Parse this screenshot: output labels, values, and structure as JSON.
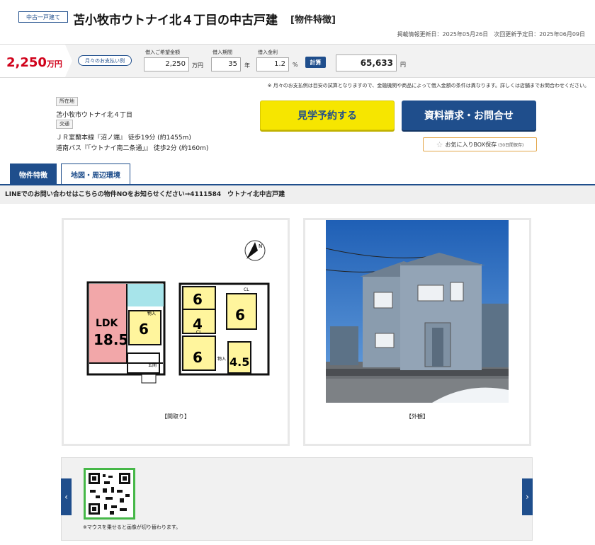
{
  "header": {
    "type_badge": "中古一戸建て",
    "title": "苫小牧市ウトナイ北４丁目の中古戸建",
    "title_suffix": "[物件特徴]",
    "dates": "掲載情報更新日：2025年05月26日　次回更新予定日：2025年06月09日"
  },
  "price": {
    "amount": "2,250",
    "unit": "万円",
    "monthly_pill": "月々のお支払い例"
  },
  "calculator": {
    "loan_label": "借入ご希望金額",
    "loan_value": "2,250",
    "loan_unit": "万円",
    "period_label": "借入期間",
    "period_value": "35",
    "period_unit": "年",
    "rate_label": "借入金利",
    "rate_value": "1.2",
    "rate_unit": "%",
    "calc_button": "計算",
    "result_value": "65,633",
    "result_unit": "円"
  },
  "disclaimer": "※ 月々のお支払例は目安の試算となりますので、金融機関や商品によって借入金額の条件は異なります。詳しくは店舗までお問合わせください。",
  "location": {
    "address_tag": "所在地",
    "address": "苫小牧市ウトナイ北４丁目",
    "transport_tag": "交通",
    "transport_1": "ＪＲ室蘭本線『沼ノ端』 徒歩19分 (約1455m)",
    "transport_2": "道南バス『「ウトナイ南二条通」』 徒歩2分 (約160m)"
  },
  "actions": {
    "visit": "見学予約する",
    "inquiry": "資料請求・お問合せ",
    "favorite": "お気に入りBOX保存",
    "favorite_note": "(30日間保存)"
  },
  "tabs": {
    "features": "物件特徴",
    "map": "地図・周辺環境"
  },
  "line_notice": "LINEでのお問い合わせはこちらの物件NOをお知らせください→4111584　ウトナイ北中古戸建",
  "photos": {
    "floorplan_caption": "【間取り】",
    "exterior_caption": "【外観】"
  },
  "floorplan": {
    "ldk_label": "LDK",
    "ldk_size": "18.5",
    "room_a": "6",
    "room_b": "6",
    "room_c": "4",
    "room_d": "6",
    "room_e": "6",
    "room_f": "4.5",
    "storage": "物入",
    "entrance": "玄関",
    "closet": "CL",
    "north": "N"
  },
  "thumbs": {
    "note": "※マウスを乗せると画像が切り替わります。",
    "prev": "‹",
    "next": "›"
  }
}
